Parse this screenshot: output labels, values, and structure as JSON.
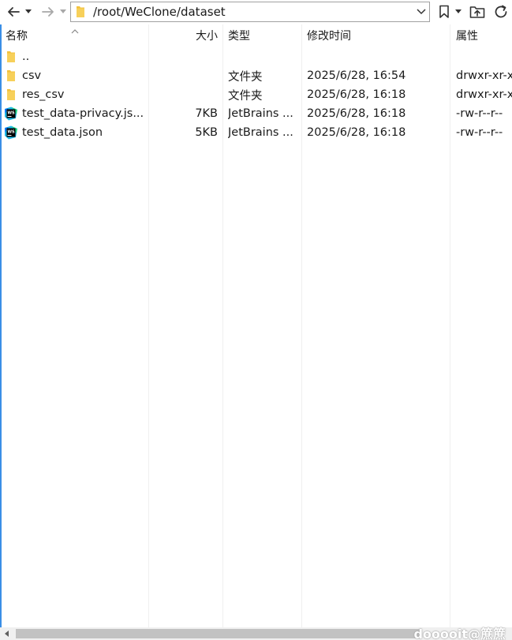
{
  "address": {
    "path": "/root/WeClone/dataset"
  },
  "columns": {
    "name": "名称",
    "size": "大小",
    "type": "类型",
    "mtime": "修改时间",
    "attr": "属性"
  },
  "files": [
    {
      "name": "..",
      "size": "",
      "type": "",
      "mtime": "",
      "attr": "",
      "icon": "folder-icon"
    },
    {
      "name": "csv",
      "size": "",
      "type": "文件夹",
      "mtime": "2025/6/28, 16:54",
      "attr": "drwxr-xr-x",
      "icon": "folder-icon"
    },
    {
      "name": "res_csv",
      "size": "",
      "type": "文件夹",
      "mtime": "2025/6/28, 16:18",
      "attr": "drwxr-xr-x",
      "icon": "folder-icon"
    },
    {
      "name": "test_data-privacy.js...",
      "size": "7KB",
      "type": "JetBrains ...",
      "mtime": "2025/6/28, 16:18",
      "attr": "-rw-r--r--",
      "icon": "webstorm-file-icon"
    },
    {
      "name": "test_data.json",
      "size": "5KB",
      "type": "JetBrains ...",
      "mtime": "2025/6/28, 16:18",
      "attr": "-rw-r--r--",
      "icon": "webstorm-file-icon"
    }
  ],
  "watermark": "dooooit@䉀䉀",
  "colors": {
    "folder": "#f3c13a",
    "accent": "#3a8ee6",
    "scroll_thumb": "#c2c2c2"
  }
}
